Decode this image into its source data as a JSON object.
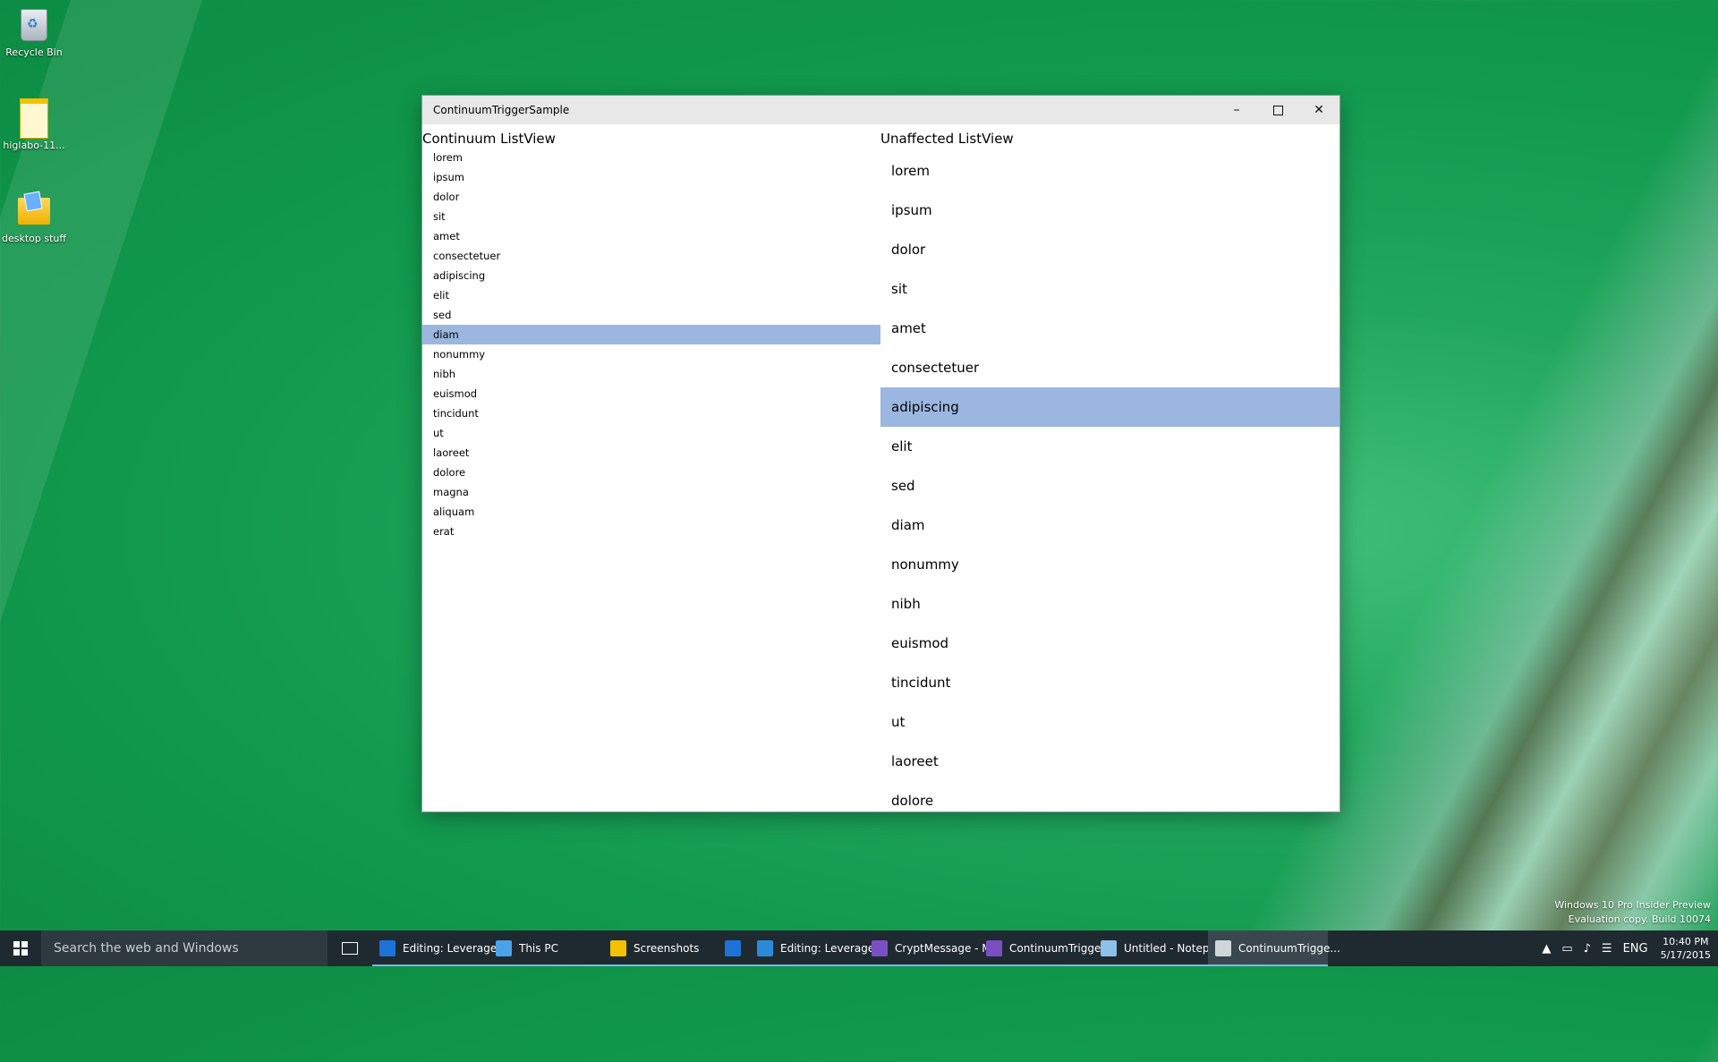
{
  "desktop": {
    "icons": [
      {
        "label": "Recycle Bin"
      },
      {
        "label": "higlabo-11..."
      },
      {
        "label": "desktop stuff"
      }
    ],
    "watermark": {
      "line1": "Windows 10 Pro Insider Preview",
      "line2": "Evaluation copy. Build 10074"
    }
  },
  "window": {
    "title": "ContinuumTriggerSample",
    "minimize_glyph": "–",
    "close_glyph": "✕",
    "left_pane": {
      "header": "Continuum ListView",
      "items": [
        "lorem",
        "ipsum",
        "dolor",
        "sit",
        "amet",
        "consectetuer",
        "adipiscing",
        "elit",
        "sed",
        "diam",
        "nonummy",
        "nibh",
        "euismod",
        "tincidunt",
        "ut",
        "laoreet",
        "dolore",
        "magna",
        "aliquam",
        "erat"
      ],
      "selected": "diam"
    },
    "right_pane": {
      "header": "Unaffected ListView",
      "items": [
        "lorem",
        "ipsum",
        "dolor",
        "sit",
        "amet",
        "consectetuer",
        "adipiscing",
        "elit",
        "sed",
        "diam",
        "nonummy",
        "nibh",
        "euismod",
        "tincidunt",
        "ut",
        "laoreet",
        "dolore"
      ],
      "selected": "adipiscing"
    }
  },
  "taskbar": {
    "search_placeholder": "Search the web and Windows",
    "tasks": [
      {
        "label": "Editing: Leverage ...",
        "icon_color": "#1e73d8"
      },
      {
        "label": "This PC",
        "icon_color": "#4aa3e8"
      },
      {
        "label": "Screenshots",
        "icon_color": "#f2c200"
      },
      {
        "label": "",
        "icon_color": "#1e73d8"
      },
      {
        "label": "Editing: Leverage ...",
        "icon_color": "#2b8ad8"
      },
      {
        "label": "CryptMessage - M...",
        "icon_color": "#7b4fc4"
      },
      {
        "label": "ContinuumTrigge...",
        "icon_color": "#7b4fc4"
      },
      {
        "label": "Untitled - Notepad",
        "icon_color": "#8fc0e8"
      },
      {
        "label": "ContinuumTrigge...",
        "icon_color": "#cfd6da"
      }
    ],
    "tray": {
      "language": "ENG",
      "time": "10:40 PM",
      "date": "5/17/2015"
    }
  },
  "colors": {
    "selection": "#9bb7e0",
    "taskbar": "#1f2a30",
    "titlebar": "#e8e8e8"
  }
}
